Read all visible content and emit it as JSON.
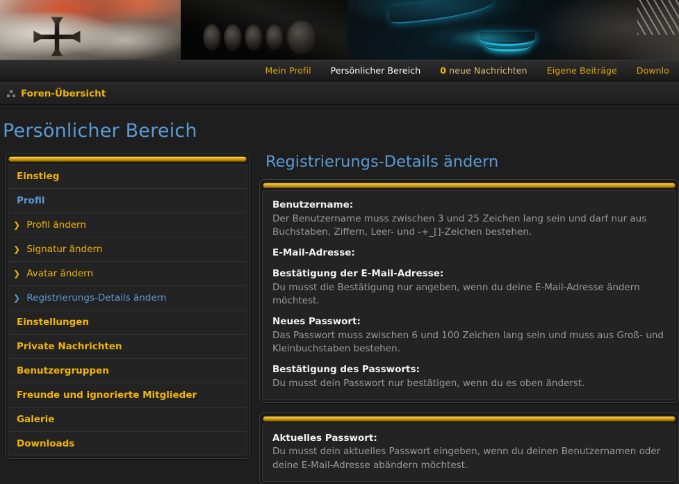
{
  "banner": {
    "alt": "forum-header-banner"
  },
  "navbar": {
    "items": [
      {
        "label": "Mein Profil",
        "name": "nav-mein-profil",
        "active": false
      },
      {
        "label": "Persönlicher Bereich",
        "name": "nav-persoenlicher-bereich",
        "active": true
      },
      {
        "label": "neue Nachrichten",
        "count": "0",
        "name": "nav-neue-nachrichten",
        "active": false
      },
      {
        "label": "Eigene Beiträge",
        "name": "nav-eigene-beitraege",
        "active": false
      },
      {
        "label": "Downlo",
        "name": "nav-downloads",
        "active": false
      }
    ]
  },
  "breadcrumb": {
    "icon": "home-icon",
    "label": "Foren-Übersicht"
  },
  "page": {
    "title": "Persönlicher Bereich"
  },
  "sidebar": {
    "items": [
      {
        "label": "Einstieg",
        "type": "head",
        "color": "gold"
      },
      {
        "label": "Profil",
        "type": "head",
        "color": "blue"
      },
      {
        "label": "Profil ändern",
        "type": "sub",
        "current": false,
        "arrow": "❯"
      },
      {
        "label": "Signatur ändern",
        "type": "sub",
        "current": false,
        "arrow": "❯"
      },
      {
        "label": "Avatar ändern",
        "type": "sub",
        "current": false,
        "arrow": "❯"
      },
      {
        "label": "Registrierungs-Details ändern",
        "type": "sub",
        "current": true,
        "arrow": "❯"
      },
      {
        "label": "Einstellungen",
        "type": "head",
        "color": "gold"
      },
      {
        "label": "Private Nachrichten",
        "type": "head",
        "color": "gold"
      },
      {
        "label": "Benutzergruppen",
        "type": "head",
        "color": "gold"
      },
      {
        "label": "Freunde und ignorierte Mitglieder",
        "type": "head",
        "color": "gold"
      },
      {
        "label": "Galerie",
        "type": "head",
        "color": "gold"
      },
      {
        "label": "Downloads",
        "type": "head",
        "color": "gold"
      }
    ]
  },
  "main": {
    "title": "Registrierungs-Details ändern",
    "panel1_fields": [
      {
        "label": "Benutzername:",
        "desc": "Der Benutzername muss zwischen 3 und 25 Zeichen lang sein und darf nur aus Buchstaben, Ziffern, Leer- und -+_[]-Zeichen bestehen."
      },
      {
        "label": "E-Mail-Adresse:",
        "desc": ""
      },
      {
        "label": "Bestätigung der E-Mail-Adresse:",
        "desc": "Du musst die Bestätigung nur angeben, wenn du deine E-Mail-Adresse ändern möchtest."
      },
      {
        "label": "Neues Passwort:",
        "desc": "Das Passwort muss zwischen 6 und 100 Zeichen lang sein und muss aus Groß- und Kleinbuchstaben bestehen."
      },
      {
        "label": "Bestätigung des Passworts:",
        "desc": "Du musst dein Passwort nur bestätigen, wenn du es oben änderst."
      }
    ],
    "panel2_fields": [
      {
        "label": "Aktuelles Passwort:",
        "desc": "Du musst dein aktuelles Passwort eingeben, wenn du deinen Benutzernamen oder deine E-Mail-Adresse abändern möchtest."
      }
    ]
  },
  "colors": {
    "gold": "#f0b40a",
    "blue": "#5b9bd5",
    "page_bg": "#1e1e1e",
    "panel_bg": "#232323",
    "label_text": "#f2f2f2",
    "desc_text": "#9a9a9a"
  }
}
